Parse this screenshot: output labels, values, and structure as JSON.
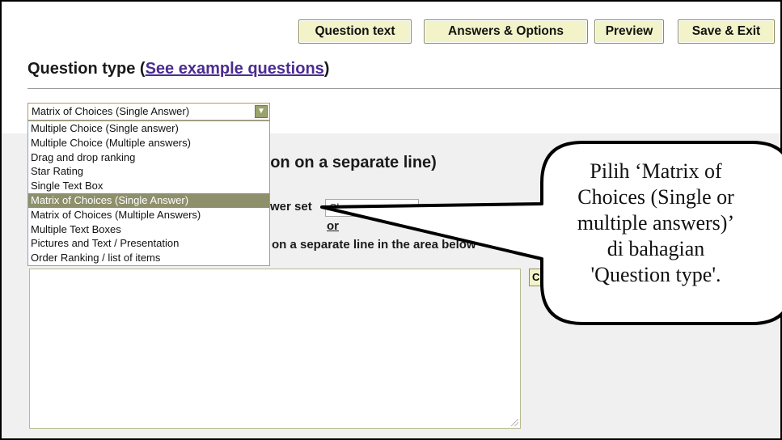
{
  "toolbar": {
    "question_text": "Question text",
    "answers_options": "Answers & Options",
    "preview": "Preview",
    "save_exit": "Save & Exit"
  },
  "question_type": {
    "title_prefix": "Question type (",
    "link": "See example questions",
    "title_suffix": ")"
  },
  "select": {
    "value": "Matrix of Choices (Single Answer)",
    "arrow": "▼",
    "options": [
      "Multiple Choice (Single answer)",
      "Multiple Choice (Multiple answers)",
      "Drag and drop ranking",
      "Star Rating",
      "Single Text Box",
      "Matrix of Choices (Single Answer)",
      "Matrix of Choices (Multiple Answers)",
      "Multiple Text Boxes",
      "Pictures and Text / Presentation",
      "Order Ranking / list of items"
    ],
    "selected_index": 5
  },
  "section": {
    "title": "tion on a separate line)",
    "answer_set_label": "wer set",
    "answer_set_value": "Cho",
    "or": "or",
    "separate_line_text": "on a separate line in the area below"
  },
  "callout": {
    "lines": [
      "Pilih ‘Matrix of",
      "Choices (Single or",
      "multiple answers)’",
      "di bahagian",
      "'Question type'."
    ]
  },
  "colors": {
    "button_bg": "#f3f3c9",
    "link": "#4b2c91",
    "selected_option": "#8e8f6b",
    "flag": "#d31d1d"
  }
}
